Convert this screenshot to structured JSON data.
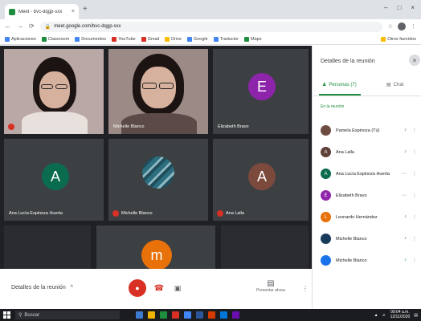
{
  "browser": {
    "tab_title": "Meet - bvc-dqgp-sxx",
    "tab_close": "×",
    "new_tab": "+",
    "window_buttons": [
      "–",
      "□",
      "×"
    ],
    "url": "meet.google.com/bvc-dqgp-sxx",
    "lock_icon": "lock-icon",
    "nav_back": "←",
    "nav_forward": "→",
    "nav_reload": "⟳",
    "toolbar_icons": [
      "☆",
      "⋮"
    ],
    "bookmarks": [
      {
        "label": "Aplicaciones",
        "color": "#4285f4"
      },
      {
        "label": "Classroom",
        "color": "#1e8e3e"
      },
      {
        "label": "Documentos",
        "color": "#4285f4"
      },
      {
        "label": "YouTube",
        "color": "#d93025"
      },
      {
        "label": "Gmail",
        "color": "#d93025"
      },
      {
        "label": "Drive",
        "color": "#fbbc04"
      },
      {
        "label": "Google",
        "color": "#4285f4"
      },
      {
        "label": "Traductor",
        "color": "#4285f4"
      },
      {
        "label": "Maps",
        "color": "#1e8e3e"
      }
    ],
    "other_bookmarks": "Otros favoritos"
  },
  "stage": {
    "tiles": [
      {
        "kind": "video",
        "name": "",
        "muted": true
      },
      {
        "kind": "video",
        "name": "Michelle Blanco",
        "muted": false
      },
      {
        "kind": "avatar",
        "letter": "E",
        "color": "#8e24aa",
        "name": "Elizabeth Bravo",
        "muted": false
      },
      {
        "kind": "avatar",
        "letter": "A",
        "color": "#0b6b4f",
        "name": "Ana Lucía Espinoza Huerta",
        "muted": false
      },
      {
        "kind": "image",
        "name": "Michelle Blanco",
        "muted": true
      },
      {
        "kind": "avatar",
        "letter": "A",
        "color": "#7b4a3c",
        "name": "Ana Lalla",
        "muted": true
      },
      {
        "kind": "empty",
        "name": ""
      },
      {
        "kind": "avatar",
        "letter": "m",
        "color": "#e8710a",
        "name": ""
      },
      {
        "kind": "empty",
        "name": ""
      }
    ]
  },
  "controls": {
    "meeting_details": "Detalles de la reunión",
    "meeting_details_chevron": "^",
    "mic_icon": "mic-off-icon",
    "end_icon": "call-end-icon",
    "cam_icon": "camera-icon",
    "present_label": "Presentar ahora",
    "more": "⋮"
  },
  "panel": {
    "title": "Detalles de la reunión",
    "close": "×",
    "tab_people": "Personas (7)",
    "tab_chat": "Chat",
    "section": "En la reunión",
    "people": [
      {
        "name": "Pamela Espinoza (Tú)",
        "avatar_color": "#6d4c41",
        "letter": "",
        "photo": true
      },
      {
        "name": "Ana Lalla",
        "avatar_color": "#5d4037",
        "letter": "A",
        "photo": false
      },
      {
        "name": "Ana Lucía Espinoza Huerta",
        "avatar_color": "#0b6b4f",
        "letter": "A",
        "photo": false
      },
      {
        "name": "Elizabeth Bravo",
        "avatar_color": "#8e24aa",
        "letter": "E",
        "photo": false
      },
      {
        "name": "Leonardo Hernández",
        "avatar_color": "#e8710a",
        "letter": "L",
        "photo": false
      },
      {
        "name": "Michelle Blanco",
        "avatar_color": "#1a3a5c",
        "letter": "",
        "photo": true
      },
      {
        "name": "Michelle Blanco",
        "avatar_color": "#1a73e8",
        "letter": "",
        "photo": true
      }
    ]
  },
  "taskbar": {
    "search_placeholder": "Buscar",
    "clock_time": "09:04 a.m.",
    "clock_date": "12/11/2020",
    "apps": [
      "#3c7bd0",
      "#f0b400",
      "#1e8e3e",
      "#d93025",
      "#4285f4",
      "#2b579a",
      "#d83b01",
      "#0078d7",
      "#6a0dad"
    ]
  }
}
